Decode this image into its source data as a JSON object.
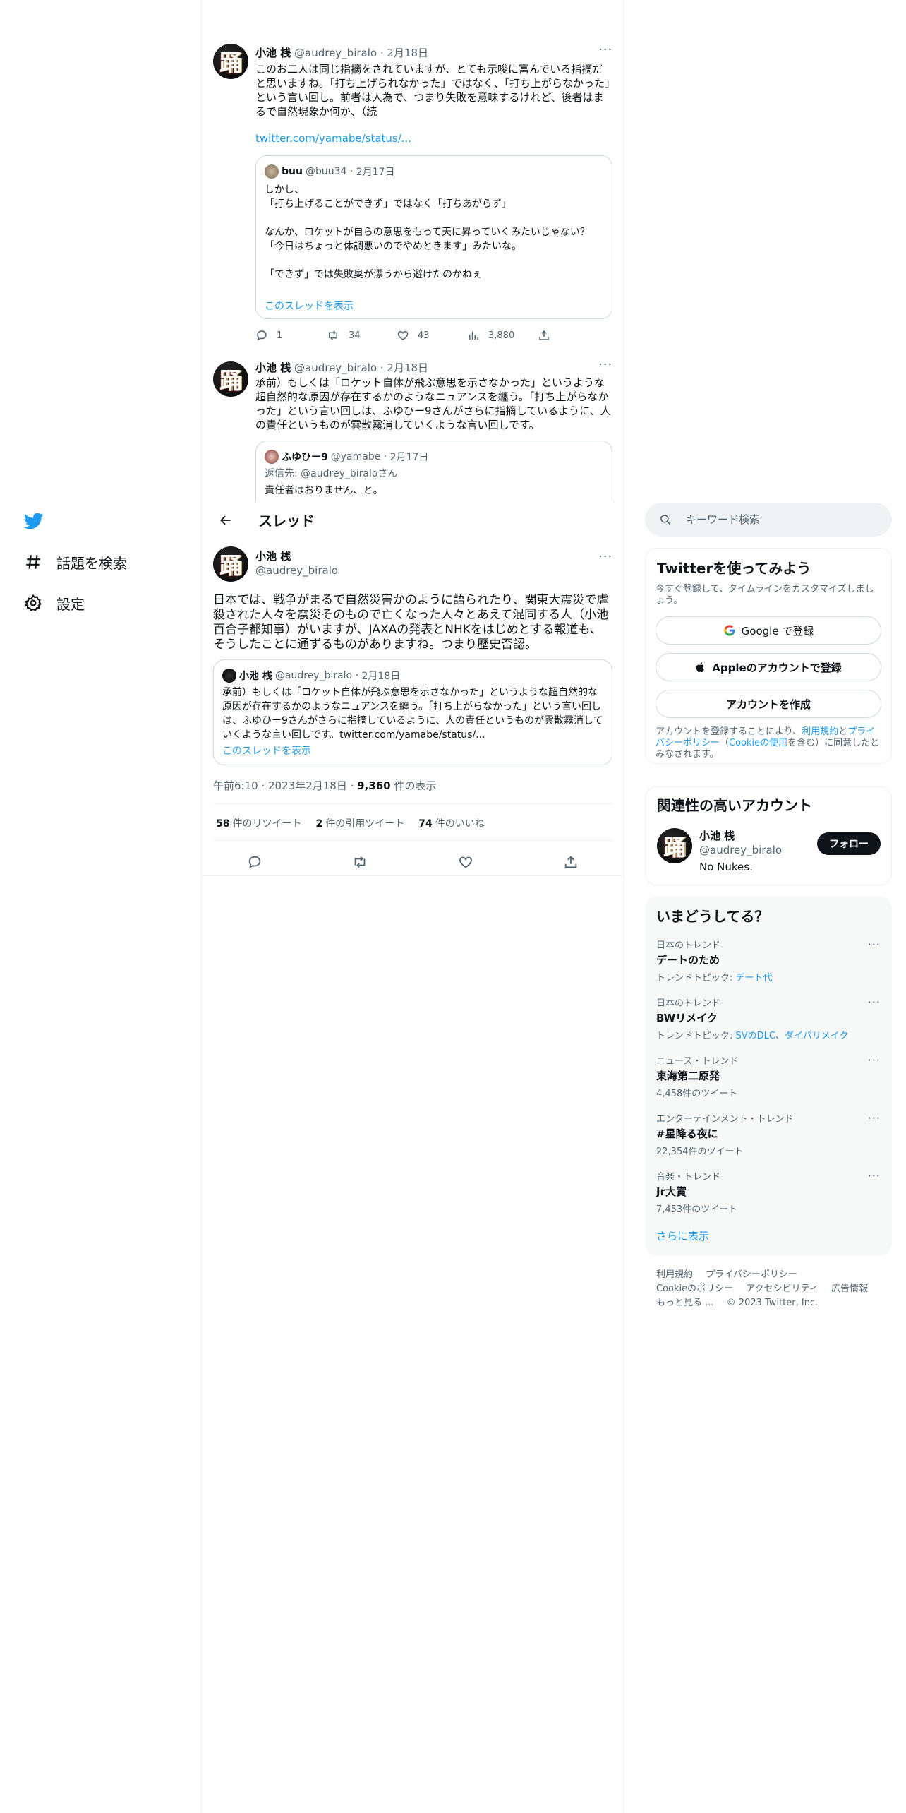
{
  "nav": {
    "logo": "twitter-bird",
    "items": [
      {
        "icon": "hashtag-icon",
        "label": "話題を検索"
      },
      {
        "icon": "gear-icon",
        "label": "設定"
      }
    ]
  },
  "thread_header": {
    "title": "スレッド"
  },
  "context_tweets": [
    {
      "name": "小池 桟",
      "handle": "@audrey_biralo",
      "date": "2月18日",
      "text": "このお二人は同じ指摘をされていますが、とても示唆に富んでいる指摘だと思いますね。「打ち上げられなかった」ではなく、「打ち上がらなかった」という言い回し。前者は人為で、つまり失敗を意味するけれど、後者はまるで自然現象か何か、（続",
      "link": "twitter.com/yamabe/status/...",
      "quote": {
        "name": "buu",
        "handle": "@buu34",
        "date": "2月17日",
        "text": "しかし、\n「打ち上げることができず」ではなく「打ちあがらず」\n\nなんか、ロケットが自らの意思をもって天に昇っていくみたいじゃない？\n「今日はちょっと体調悪いのでやめときます」みたいな。\n\n「できず」では失敗臭が漂うから避けたのかねぇ",
        "show_thread": "このスレッドを表示"
      },
      "actions": {
        "reply": "1",
        "retweet": "34",
        "like": "43",
        "views": "3,880"
      }
    },
    {
      "name": "小池 桟",
      "handle": "@audrey_biralo",
      "date": "2月18日",
      "text": "承前）もしくは「ロケット自体が飛ぶ意思を示さなかった」というような超自然的な原因が存在するかのようなニュアンスを纏う。「打ち上がらなかった」という言い回しは、ふゆひー9さんがさらに指摘しているように、人の責任というものが雲散霧消していくような言い回しです。",
      "quote": {
        "name": "ふゆひー9",
        "handle": "@yamabe",
        "date": "2月17日",
        "reply_to": "返信先: @audrey_biraloさん",
        "text": "責任者はおりません、と。"
      }
    }
  ],
  "main_tweet": {
    "name": "小池 桟",
    "handle": "@audrey_biralo",
    "text": "日本では、戦争がまるで自然災害かのように語られたり、関東大震災で虐殺された人々を震災そのもので亡くなった人々とあえて混同する人（小池百合子都知事）がいますが、JAXAの発表とNHKをはじめとする報道も、そうしたことに通ずるものがありますね。つまり歴史否認。",
    "quote": {
      "name": "小池 桟",
      "handle": "@audrey_biralo",
      "date": "2月18日",
      "text": "承前）もしくは「ロケット自体が飛ぶ意思を示さなかった」というような超自然的な原因が存在するかのようなニュアンスを纏う。「打ち上がらなかった」という言い回しは、ふゆひー9さんがさらに指摘しているように、人の責任というものが雲散霧消していくような言い回しです。twitter.com/yamabe/status/...",
      "show_thread": "このスレッドを表示"
    },
    "time": "午前6:10",
    "date": "2023年2月18日",
    "views_count": "9,360",
    "views_label": "件の表示",
    "stats": [
      {
        "count": "58",
        "label": "件のリツイート"
      },
      {
        "count": "2",
        "label": "件の引用ツイート"
      },
      {
        "count": "74",
        "label": "件のいいね"
      }
    ]
  },
  "search": {
    "placeholder": "キーワード検索"
  },
  "signup": {
    "title": "Twitterを使ってみよう",
    "subtitle": "今すぐ登録して、タイムラインをカスタマイズしましょう。",
    "google": "Google で登録",
    "apple": "Appleのアカウントで登録",
    "create": "アカウントを作成",
    "legal_prefix": "アカウントを登録することにより、",
    "legal_terms": "利用規約",
    "legal_and": "と",
    "legal_privacy": "プライバシーポリシー",
    "legal_paren_open": "（",
    "legal_cookie": "Cookieの使用",
    "legal_suffix": "を含む）に同意したとみなされます。"
  },
  "related": {
    "title": "関連性の高いアカウント",
    "name": "小池 桟",
    "handle": "@audrey_biralo",
    "bio": "No Nukes.",
    "follow": "フォロー"
  },
  "trends": {
    "title": "いまどうしてる？",
    "items": [
      {
        "category": "日本のトレンド",
        "name": "デートのため",
        "sub_prefix": "トレンドトピック: ",
        "sub_links": [
          "デート代"
        ]
      },
      {
        "category": "日本のトレンド",
        "name": "BWリメイク",
        "sub_prefix": "トレンドトピック: ",
        "sub_links": [
          "SVのDLC",
          "ダイパリメイク"
        ]
      },
      {
        "category": "ニュース・トレンド",
        "name": "東海第二原発",
        "sub": "4,458件のツイート"
      },
      {
        "category": "エンターテインメント・トレンド",
        "name": "#星降る夜に",
        "sub": "22,354件のツイート"
      },
      {
        "category": "音楽・トレンド",
        "name": "Jr大賞",
        "sub": "7,453件のツイート"
      }
    ],
    "show_more": "さらに表示"
  },
  "footer": {
    "links": [
      "利用規約",
      "プライバシーポリシー",
      "Cookieのポリシー",
      "アクセシビリティ",
      "広告情報",
      "もっと見る ..."
    ],
    "copyright": "© 2023 Twitter, Inc."
  },
  "colors": {
    "accent": "#1d9bf0",
    "text": "#0f1419",
    "muted": "#536471",
    "border": "#eff3f4"
  }
}
